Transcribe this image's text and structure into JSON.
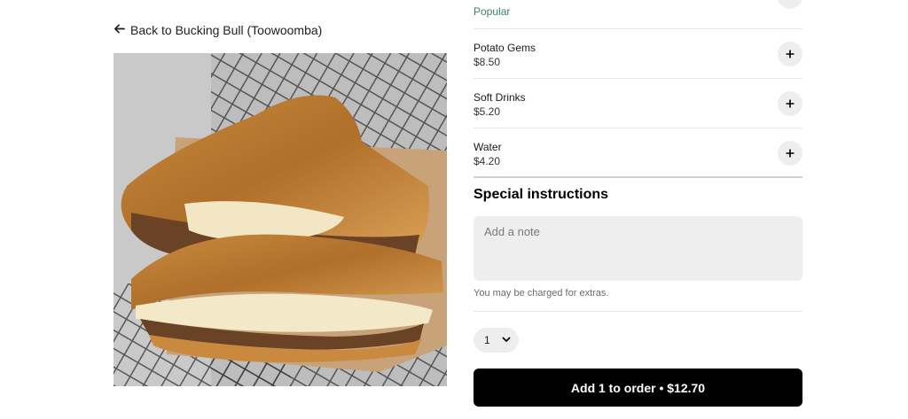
{
  "nav": {
    "back_label": "Back to Bucking Bull (Toowoomba)"
  },
  "item": {
    "image_icon": "grilled-cheese-sandwich-photo"
  },
  "partial_option": {
    "tag": "Popular",
    "tag_color": "#3d8065"
  },
  "options": [
    {
      "name": "Potato Gems",
      "price": "$8.50"
    },
    {
      "name": "Soft Drinks",
      "price": "$5.20"
    },
    {
      "name": "Water",
      "price": "$4.20"
    }
  ],
  "special_instructions": {
    "title": "Special instructions",
    "placeholder": "Add a note",
    "charge_note": "You may be charged for extras."
  },
  "quantity": {
    "value": "1"
  },
  "cta": {
    "label": "Add 1 to order • $12.70",
    "color": "#000000"
  }
}
